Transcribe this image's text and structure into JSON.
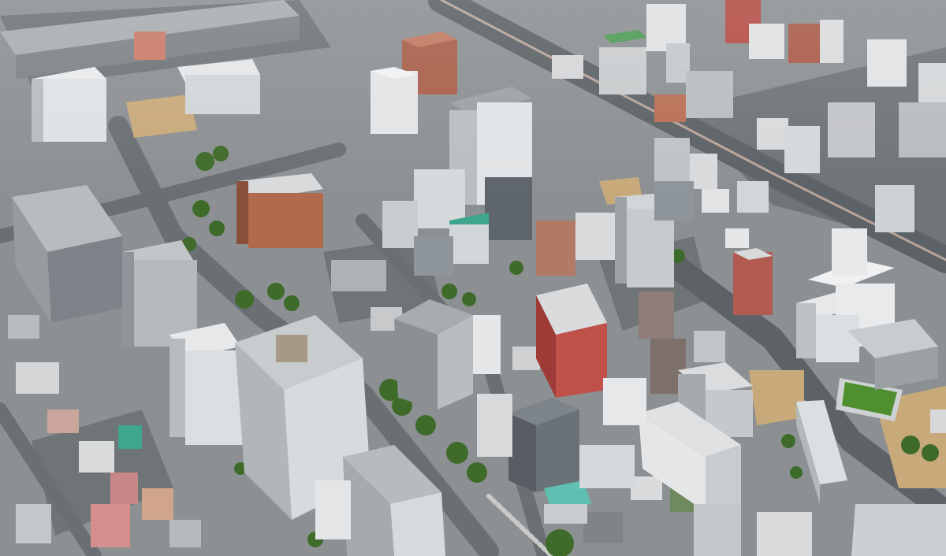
{
  "view": {
    "kind": "aerial-3d-city-view",
    "palette": {
      "ground": "#8c9093",
      "road": "#5d6266",
      "road_light": "#a7a9aa",
      "parking": "#6f7477",
      "tree": "#3f6b2a",
      "tree_light": "#5d8a3a",
      "field_green": "#4f8f2f",
      "dirt": "#c8a97a",
      "brick": "#b06a4c",
      "red_building": "#c0504a",
      "white_building": "#e6e8ea",
      "gray_building": "#8e959b",
      "teal_roof": "#3fa58e"
    }
  }
}
